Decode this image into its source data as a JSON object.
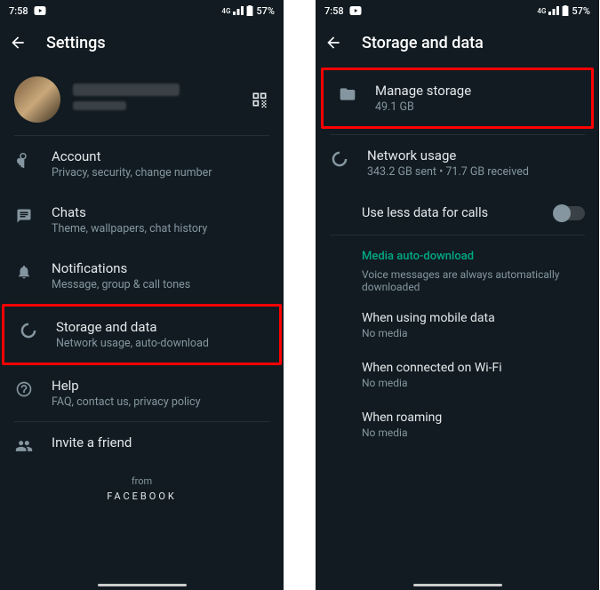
{
  "status": {
    "time": "7:58",
    "battery": "57%"
  },
  "left": {
    "title": "Settings",
    "account": {
      "title": "Account",
      "sub": "Privacy, security, change number"
    },
    "chats": {
      "title": "Chats",
      "sub": "Theme, wallpapers, chat history"
    },
    "notifications": {
      "title": "Notifications",
      "sub": "Message, group & call tones"
    },
    "storage": {
      "title": "Storage and data",
      "sub": "Network usage, auto-download"
    },
    "help": {
      "title": "Help",
      "sub": "FAQ, contact us, privacy policy"
    },
    "invite": {
      "title": "Invite a friend"
    },
    "footer_from": "from",
    "footer_brand": "FACEBOOK"
  },
  "right": {
    "title": "Storage and data",
    "manage": {
      "title": "Manage storage",
      "sub": "49.1 GB"
    },
    "network": {
      "title": "Network usage",
      "sub": "343.2 GB sent • 71.7 GB received"
    },
    "lessdata": "Use less data for calls",
    "media_header": "Media auto-download",
    "media_desc": "Voice messages are always automatically downloaded",
    "mobile": {
      "title": "When using mobile data",
      "sub": "No media"
    },
    "wifi": {
      "title": "When connected on Wi-Fi",
      "sub": "No media"
    },
    "roaming": {
      "title": "When roaming",
      "sub": "No media"
    }
  }
}
